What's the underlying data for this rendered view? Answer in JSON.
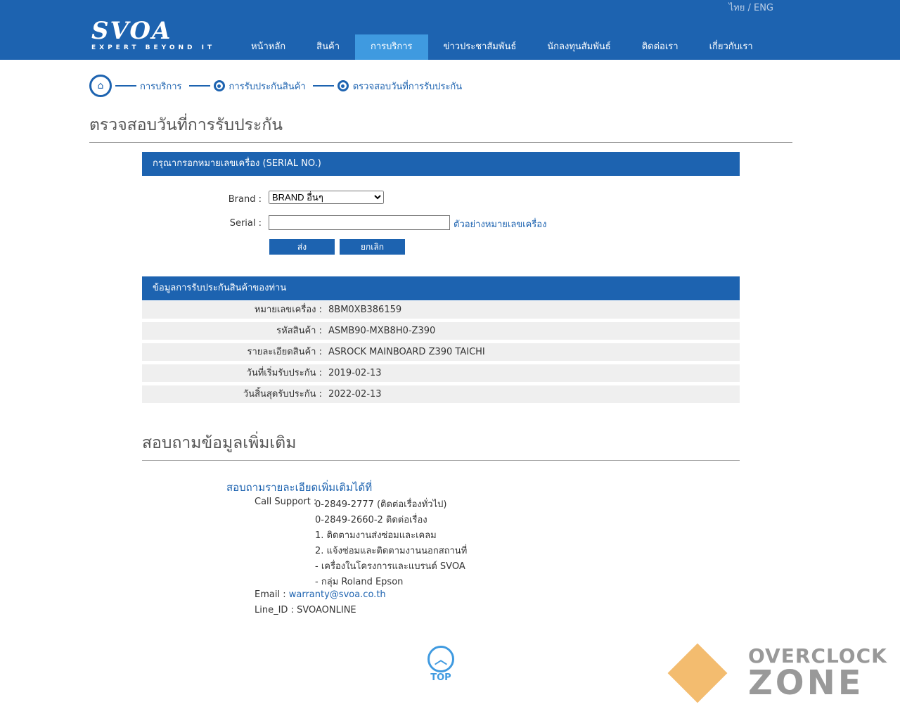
{
  "header": {
    "lang": "ไทย / ENG",
    "logo": "SVOA",
    "tagline": "EXPERT BEYOND IT",
    "nav": [
      "หน้าหลัก",
      "สินค้า",
      "การบริการ",
      "ข่าวประชาสัมพันธ์",
      "นักลงทุนสัมพันธ์",
      "ติดต่อเรา",
      "เกี่ยวกับเรา"
    ],
    "active_index": 2
  },
  "breadcrumb": [
    "การบริการ",
    "การรับประกันสินค้า",
    "ตรวจสอบวันที่การรับประกัน"
  ],
  "page_title": "ตรวจสอบวันที่การรับประกัน",
  "form": {
    "header": "กรุณากรอกหมายเลขเครื่อง (SERIAL NO.)",
    "brand_label": "Brand :",
    "brand_value": "BRAND อื่นๆ",
    "serial_label": "Serial :",
    "serial_value": "",
    "example_link": "ตัวอย่างหมายเลขเครื่อง",
    "submit": "ส่ง",
    "cancel": "ยกเลิก"
  },
  "result": {
    "header": "ข้อมูลการรับประกันสินค้าของท่าน",
    "rows": [
      {
        "k": "หมายเลขเครื่อง :",
        "v": "8BM0XB386159"
      },
      {
        "k": "รหัสสินค้า :",
        "v": "ASMB90-MXB8H0-Z390"
      },
      {
        "k": "รายละเอียดสินค้า :",
        "v": "ASROCK MAINBOARD Z390 TAICHI"
      },
      {
        "k": "วันที่เริ่มรับประกัน :",
        "v": "2019-02-13"
      },
      {
        "k": "วันสิ้นสุดรับประกัน :",
        "v": "2022-02-13"
      }
    ]
  },
  "contact": {
    "title": "สอบถามข้อมูลเพิ่มเติม",
    "subtitle": "สอบถามรายละเอียดเพิ่มเติมได้ที่",
    "call_label": "Call Support :",
    "lines": [
      "0-2849-2777 (ติดต่อเรื่องทั่วไป)",
      "0-2849-2660-2 ติดต่อเรื่อง",
      "1. ติดตามงานส่งซ่อมและเคลม",
      "2. แจ้งซ่อมและติดตามงานนอกสถานที่",
      "- เครื่องในโครงการและแบรนด์ SVOA",
      "- กลุ่ม Roland Epson"
    ],
    "email_label": "Email :",
    "email": "warranty@svoa.co.th",
    "line_label": "Line_ID :",
    "line_id": "SVOAONLINE"
  },
  "top": "TOP",
  "watermark": {
    "l1": "OVERCLOCK",
    "l2": "ZONE"
  }
}
